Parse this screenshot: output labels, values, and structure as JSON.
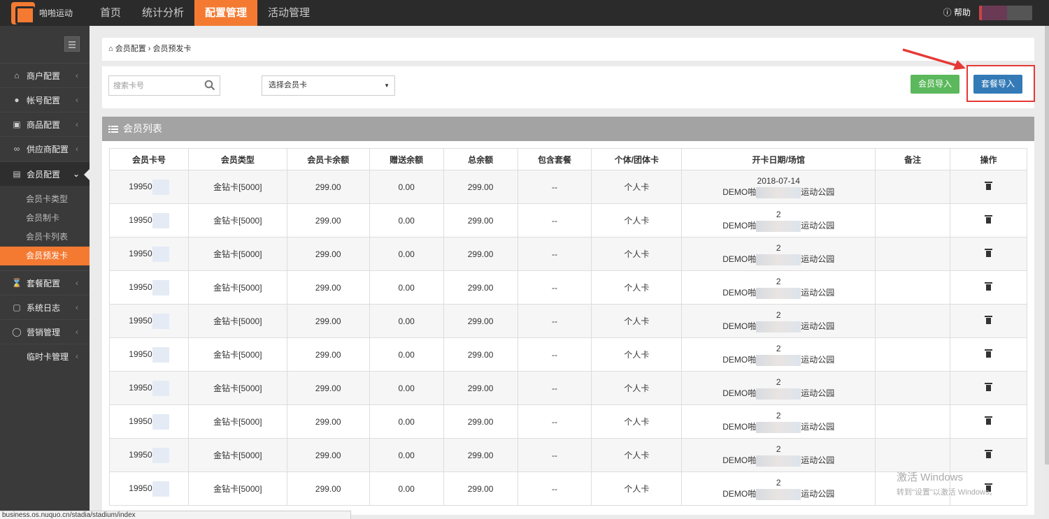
{
  "header": {
    "brand": "啪啪运动",
    "nav": [
      {
        "label": "首页",
        "active": false
      },
      {
        "label": "统计分析",
        "active": false
      },
      {
        "label": "配置管理",
        "active": true
      },
      {
        "label": "活动管理",
        "active": false
      }
    ],
    "help": "帮助"
  },
  "sidebar": {
    "items": [
      {
        "label": "商户配置",
        "icon": "home-icon"
      },
      {
        "label": "帐号配置",
        "icon": "user-icon"
      },
      {
        "label": "商品配置",
        "icon": "gift-icon"
      },
      {
        "label": "供应商配置",
        "icon": "link-icon"
      },
      {
        "label": "会员配置",
        "icon": "id-card-icon",
        "open": true
      },
      {
        "label": "套餐配置",
        "icon": "hourglass-icon"
      },
      {
        "label": "系统日志",
        "icon": "edit-icon"
      },
      {
        "label": "营销管理",
        "icon": "chat-icon"
      },
      {
        "label": "临时卡管理",
        "icon": ""
      }
    ],
    "subitems": [
      {
        "label": "会员卡类型",
        "active": false
      },
      {
        "label": "会员制卡",
        "active": false
      },
      {
        "label": "会员卡列表",
        "active": false
      },
      {
        "label": "会员预发卡",
        "active": true
      }
    ]
  },
  "breadcrumb": {
    "root": "会员配置",
    "current": "会员预发卡"
  },
  "toolbar": {
    "search_placeholder": "搜索卡号",
    "select_value": "选择会员卡",
    "import_member": "会员导入",
    "import_package": "套餐导入"
  },
  "panel": {
    "title": "会员列表"
  },
  "table": {
    "columns": [
      "会员卡号",
      "会员类型",
      "会员卡余额",
      "赠送余额",
      "总余额",
      "包含套餐",
      "个体/团体卡",
      "开卡日期/场馆",
      "备注",
      "操作"
    ],
    "rows": [
      {
        "card_no": "19950",
        "type": "金钻卡[5000]",
        "balance": "299.00",
        "gift": "0.00",
        "total": "299.00",
        "package": "--",
        "kind": "个人卡",
        "date": "2018-07-14",
        "venue_pre": "DEMO啪",
        "venue_post": "运动公园"
      },
      {
        "card_no": "19950",
        "type": "金钻卡[5000]",
        "balance": "299.00",
        "gift": "0.00",
        "total": "299.00",
        "package": "--",
        "kind": "个人卡",
        "date": "2",
        "venue_pre": "DEMO啪",
        "venue_post": "运动公园"
      },
      {
        "card_no": "19950",
        "type": "金钻卡[5000]",
        "balance": "299.00",
        "gift": "0.00",
        "total": "299.00",
        "package": "--",
        "kind": "个人卡",
        "date": "2",
        "venue_pre": "DEMO啪",
        "venue_post": "运动公园"
      },
      {
        "card_no": "19950",
        "type": "金钻卡[5000]",
        "balance": "299.00",
        "gift": "0.00",
        "total": "299.00",
        "package": "--",
        "kind": "个人卡",
        "date": "2",
        "venue_pre": "DEMO啪",
        "venue_post": "运动公园"
      },
      {
        "card_no": "19950",
        "type": "金钻卡[5000]",
        "balance": "299.00",
        "gift": "0.00",
        "total": "299.00",
        "package": "--",
        "kind": "个人卡",
        "date": "2",
        "venue_pre": "DEMO啪",
        "venue_post": "运动公园"
      },
      {
        "card_no": "19950",
        "type": "金钻卡[5000]",
        "balance": "299.00",
        "gift": "0.00",
        "total": "299.00",
        "package": "--",
        "kind": "个人卡",
        "date": "2",
        "venue_pre": "DEMO啪",
        "venue_post": "运动公园"
      },
      {
        "card_no": "19950",
        "type": "金钻卡[5000]",
        "balance": "299.00",
        "gift": "0.00",
        "total": "299.00",
        "package": "--",
        "kind": "个人卡",
        "date": "2",
        "venue_pre": "DEMO啪",
        "venue_post": "运动公园"
      },
      {
        "card_no": "19950",
        "type": "金钻卡[5000]",
        "balance": "299.00",
        "gift": "0.00",
        "total": "299.00",
        "package": "--",
        "kind": "个人卡",
        "date": "2",
        "venue_pre": "DEMO啪",
        "venue_post": "运动公园"
      },
      {
        "card_no": "19950",
        "type": "金钻卡[5000]",
        "balance": "299.00",
        "gift": "0.00",
        "total": "299.00",
        "package": "--",
        "kind": "个人卡",
        "date": "2",
        "venue_pre": "DEMO啪",
        "venue_post": "运动公园"
      },
      {
        "card_no": "19950",
        "type": "金钻卡[5000]",
        "balance": "299.00",
        "gift": "0.00",
        "total": "299.00",
        "package": "--",
        "kind": "个人卡",
        "date": "2",
        "venue_pre": "DEMO啪",
        "venue_post": "运动公园"
      }
    ]
  },
  "watermark": {
    "title": "激活 Windows",
    "subtitle": "转到\"设置\"以激活 Windows。"
  },
  "status_url": "business.os.nuquo.cn/stadia/stadium/index",
  "colors": {
    "accent": "#f47a32",
    "topbar": "#2b2b2b",
    "sidebar": "#3a3a3a",
    "green": "#5cb85c",
    "blue": "#337ab7",
    "highlight": "#e53935"
  }
}
